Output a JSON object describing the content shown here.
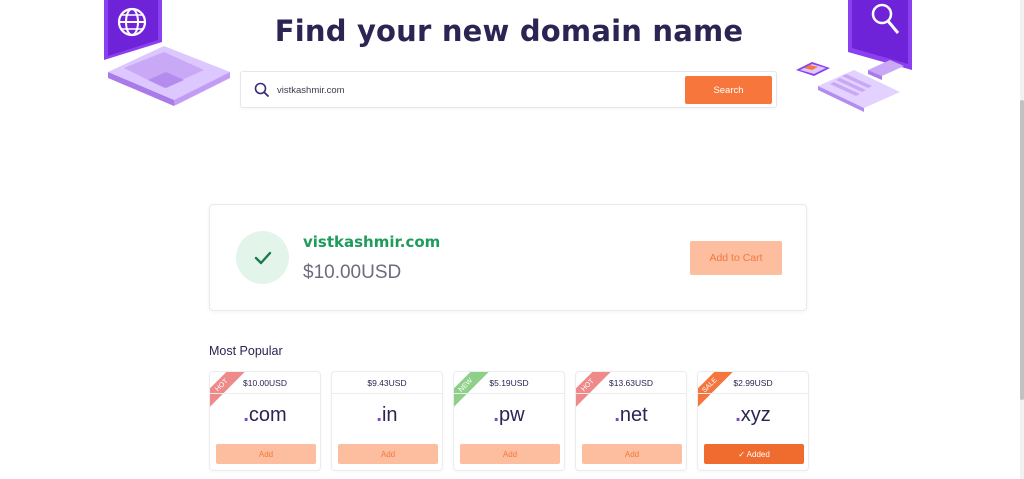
{
  "header": {
    "title": "Find your new domain name"
  },
  "search": {
    "value": "vistkashmir.com",
    "button_label": "Search"
  },
  "result": {
    "domain": "vistkashmir.com",
    "price": "$10.00USD",
    "cart_label": "Add to Cart",
    "status_icon": "checkmark-icon",
    "status_color": "#1d9c5b"
  },
  "popular": {
    "title": "Most Popular",
    "items": [
      {
        "price": "$10.00USD",
        "dot": ".",
        "tld": "com",
        "ribbon": "HOT",
        "ribbon_color": "#ef8a8a",
        "button": "Add",
        "added": false
      },
      {
        "price": "$9.43USD",
        "dot": ".",
        "tld": "in",
        "ribbon": "",
        "ribbon_color": "",
        "button": "Add",
        "added": false
      },
      {
        "price": "$5.19USD",
        "dot": ".",
        "tld": "pw",
        "ribbon": "NEW",
        "ribbon_color": "#8ed08a",
        "button": "Add",
        "added": false
      },
      {
        "price": "$13.63USD",
        "dot": ".",
        "tld": "net",
        "ribbon": "HOT",
        "ribbon_color": "#ef8a8a",
        "button": "Add",
        "added": false
      },
      {
        "price": "$2.99USD",
        "dot": ".",
        "tld": "xyz",
        "ribbon": "SALE",
        "ribbon_color": "#f4763d",
        "button": "Added",
        "added": true
      }
    ]
  },
  "colors": {
    "accent": "#f7763b",
    "accent_light": "#fcbe9e",
    "brand_purple": "#7b46d4",
    "text_dark": "#2a2553"
  }
}
